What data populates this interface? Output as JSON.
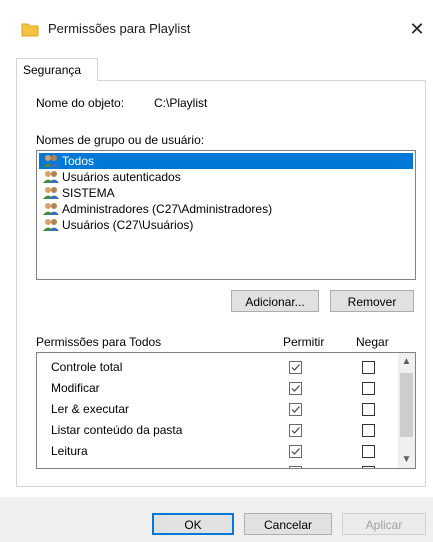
{
  "window": {
    "title": "Permissões para Playlist",
    "close": "✕"
  },
  "tabs": [
    {
      "label": "Segurança"
    }
  ],
  "object": {
    "label": "Nome do objeto:",
    "value": "C:\\Playlist"
  },
  "groups": {
    "label": "Nomes de grupo ou de usuário:",
    "items": [
      {
        "label": "Todos",
        "selected": true
      },
      {
        "label": "Usuários autenticados",
        "selected": false
      },
      {
        "label": "SISTEMA",
        "selected": false
      },
      {
        "label": "Administradores (C27\\Administradores)",
        "selected": false
      },
      {
        "label": "Usuários (C27\\Usuários)",
        "selected": false
      }
    ]
  },
  "buttons": {
    "add": "Adicionar...",
    "remove": "Remover",
    "ok": "OK",
    "cancel": "Cancelar",
    "apply": "Aplicar"
  },
  "permissions": {
    "label": "Permissões para Todos",
    "allow_header": "Permitir",
    "deny_header": "Negar",
    "rows": [
      {
        "name": "Controle total",
        "allow": true,
        "deny": false
      },
      {
        "name": "Modificar",
        "allow": true,
        "deny": false
      },
      {
        "name": "Ler & executar",
        "allow": true,
        "deny": false
      },
      {
        "name": "Listar conteúdo da pasta",
        "allow": true,
        "deny": false
      },
      {
        "name": "Leitura",
        "allow": true,
        "deny": false
      },
      {
        "name": "",
        "allow": true,
        "deny": false
      }
    ]
  },
  "scroll": {
    "up": "▲",
    "down": "▼"
  },
  "colors": {
    "selection": "#0078d7",
    "folder": "#f5c342"
  }
}
